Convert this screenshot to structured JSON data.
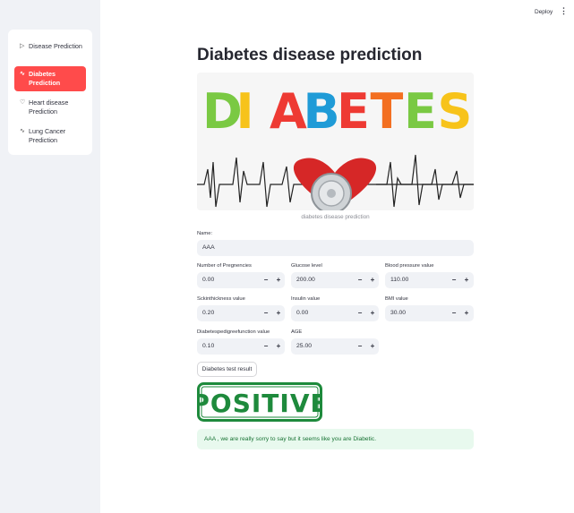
{
  "topbar": {
    "deploy_label": "Deploy",
    "menu_icon": "⋮"
  },
  "sidebar": {
    "items": [
      {
        "label": "Disease Prediction",
        "icon": "▷",
        "active": false
      },
      {
        "label": "Diabetes Prediction",
        "icon": "∿",
        "active": true
      },
      {
        "label": "Heart disease Prediction",
        "icon": "♡",
        "active": false
      },
      {
        "label": "Lung Cancer Prediction",
        "icon": "∿",
        "active": false
      }
    ]
  },
  "main": {
    "title": "Diabetes disease prediction",
    "image_caption": "diabetes disease prediction",
    "hero_letters": [
      "D",
      "I",
      "A",
      "B",
      "E",
      "T",
      "E",
      "S"
    ],
    "name_label": "Name:",
    "name_value": "AAA",
    "fields": {
      "pregnancies": {
        "label": "Number of Pregnencies",
        "value": "0.00"
      },
      "glucose": {
        "label": "Glucose level",
        "value": "200.00"
      },
      "bp": {
        "label": "Blood pressure value",
        "value": "110.00"
      },
      "skin": {
        "label": "Sckinthickness value",
        "value": "0.20"
      },
      "insulin": {
        "label": "Insulin value",
        "value": "0.00"
      },
      "bmi": {
        "label": "BMI value",
        "value": "30.00"
      },
      "dpf": {
        "label": "Diabetespedigreefunction value",
        "value": "0.10"
      },
      "age": {
        "label": "AGE",
        "value": "25.00"
      }
    },
    "stepper": {
      "minus": "−",
      "plus": "+"
    },
    "button_label": "Diabetes test result",
    "stamp_text": "POSITIVE",
    "result_message": "AAA , we are really sorry to say but it seems like you are Diabetic."
  },
  "colors": {
    "accent": "#ff4b4b",
    "stamp_green": "#1e8a3c",
    "success_bg": "#e8f9ee",
    "hero_letter_colors": [
      "#7ac943",
      "#f7c31a",
      "#ee3a33",
      "#1f9bd7",
      "#ee3a33",
      "#f36f21",
      "#7ac943",
      "#f7c31a"
    ]
  }
}
